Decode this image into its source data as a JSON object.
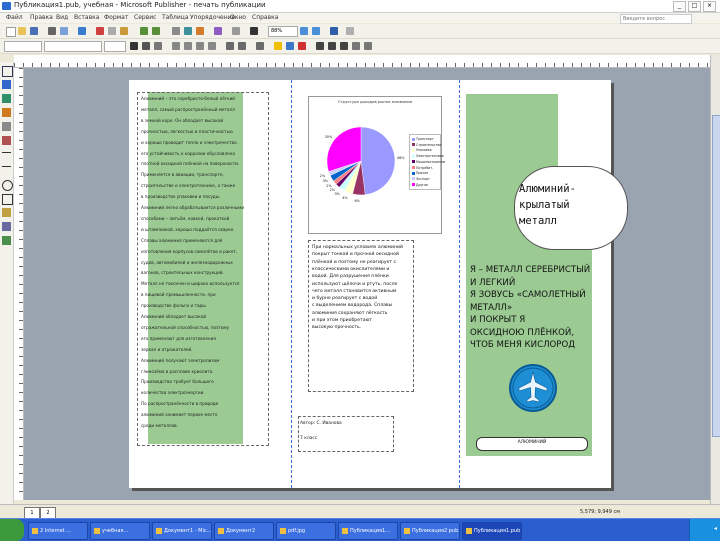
{
  "window": {
    "title": "Публикация1.pub, учебная - Microsoft Publisher - печать публикации",
    "search_placeholder": "Введите вопрос"
  },
  "menu": [
    "Файл",
    "Правка",
    "Вид",
    "Вставка",
    "Формат",
    "Сервис",
    "Таблица",
    "Упорядочение",
    "Окно",
    "Справка"
  ],
  "toolbar": {
    "zoom": "88%"
  },
  "chart": {
    "title": "Структура доходов рынка алюминия",
    "chart_data": {
      "type": "pie",
      "title": "Структура доходов рынка алюминия",
      "labels": [
        "Транспорт",
        "Строительство",
        "Упаковка",
        "Электротехника",
        "Машиностроение",
        "Потребит.",
        "Прочее",
        "Экспорт",
        "Другое"
      ],
      "values": [
        48,
        6,
        4,
        3,
        2,
        2,
        3,
        2,
        30
      ],
      "value_labels": [
        "48%",
        "6%",
        "4%",
        "3%",
        "2%",
        "2%",
        "3%",
        "2%",
        "30%"
      ],
      "legend": "right"
    },
    "colors": [
      "#9999ff",
      "#993366",
      "#ffffcc",
      "#ccffff",
      "#660066",
      "#ff8080",
      "#0066cc",
      "#ccccff",
      "#ff00ff"
    ]
  },
  "left_column": {
    "lines": [
      "Алюминий – это серебристо-белый лёгкий",
      "металл, самый распространённый металл",
      "в земной коре. Он обладает высокой",
      "прочностью, легкостью и пластичностью",
      "и хорошо проводит тепло и электричество,",
      "его устойчивость к коррозии обусловлена",
      "плотной оксидной плёнкой на поверхности.",
      "Применяется в авиации, транспорте,",
      "строительстве и электротехнике, а также",
      "в производстве упаковки и посуды.",
      "Алюминий легко обрабатывается различными",
      "способами – литьём, ковкой, прокаткой",
      "и штамповкой, хорошо поддаётся сварке.",
      "Сплавы алюминия применяются для",
      "изготовления корпусов самолётов и ракет,",
      "судов, автомобилей и железнодорожных",
      "вагонов, строительных конструкций.",
      "Металл не токсичен и широко используется",
      "в пищевой промышленности, при",
      "производстве фольги и тары.",
      "Алюминий обладает высокой",
      "отражательной способностью, поэтому",
      "его применяют для изготовления",
      "зеркал и отражателей.",
      "Алюминий получают электролизом",
      "глинозёма в расплаве криолита.",
      "Производство требует большого",
      "количества электроэнергии.",
      "По распространённости в природе",
      "алюминий занимает первое место",
      "среди металлов."
    ]
  },
  "middle_column": {
    "lines": [
      "При нормальных условиях алюминий",
      "покрыт тонкой и прочной оксидной",
      "плёнкой и поэтому не реагирует с",
      "классическими окислителями и",
      "водой. Для разрушения плёнки",
      "используют щёлочи и ртуть, после",
      "чего металл становится активным",
      "и бурно реагирует с водой",
      "с выделением водорода. Сплавы",
      "алюминия сохраняют лёгкость",
      "и при этом приобретают",
      "высокую прочность."
    ],
    "author": "Автор: С. Иванова",
    "class": "7 класс"
  },
  "right_column": {
    "heading": "Алюминий-крылатый металл",
    "heading_lines": [
      "Алюминий-",
      "крылатый",
      "металл"
    ],
    "body_lines": [
      "Я – МЕТАЛЛ СЕРЕБРИСТЫЙ",
      "И ЛЕГКИЙ",
      "Я ЗОВУСЬ «САМОЛЕТНЫЙ",
      "МЕТАЛЛ»",
      "И ПОКРЫТ Я",
      "ОКСИДНОЮ ПЛЁНКОЙ,",
      "ЧТОБ МЕНЯ КИСЛОРОД"
    ],
    "logo_caption": "АЛЮМИНИЙ"
  },
  "statusbar": {
    "page1": "1",
    "page2": "2",
    "coords": "5,579; 9,949 см"
  },
  "taskbar": {
    "tasks": [
      "2 Internet ...",
      "учебная...",
      "Документ1 - Mic...",
      "Документ2",
      "pdf.jpg",
      "Публикация1...",
      "Публикация2 pub...",
      "Публикация1.pub"
    ]
  }
}
